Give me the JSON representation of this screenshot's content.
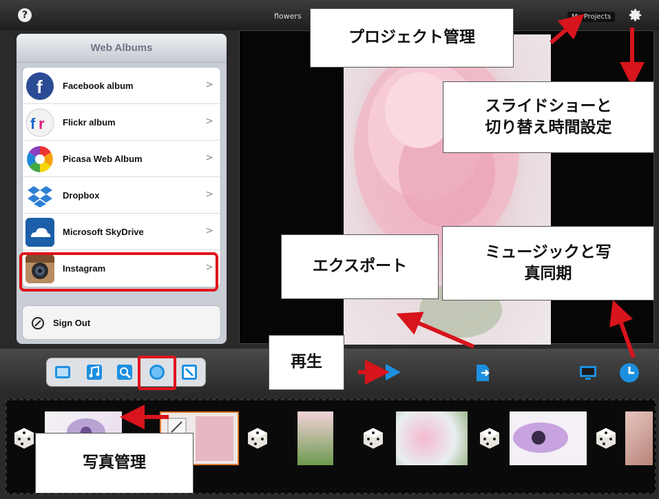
{
  "topbar": {
    "help_label": "?",
    "title": "flowers",
    "my_projects_label": "My Projects"
  },
  "sidebar": {
    "title": "Web Albums",
    "items": [
      {
        "label": "Facebook album",
        "icon": "facebook-icon"
      },
      {
        "label": "Flickr album",
        "icon": "flickr-icon"
      },
      {
        "label": "Picasa Web Album",
        "icon": "picasa-icon"
      },
      {
        "label": "Dropbox",
        "icon": "dropbox-icon"
      },
      {
        "label": "Microsoft SkyDrive",
        "icon": "skydrive-icon"
      },
      {
        "label": "Instagram",
        "icon": "instagram-icon"
      }
    ],
    "sign_out_label": "Sign Out",
    "chevron": ">"
  },
  "annotations": {
    "project": "プロジェクト管理",
    "slideshow_line1": "スライドショーと",
    "slideshow_line2": "切り替え時間設定",
    "export": "エクスポート",
    "music_line1": "ミュージックと写",
    "music_line2": "真同期",
    "play": "再生",
    "photo_manage": "写真管理"
  },
  "colors": {
    "highlight": "#e0141c",
    "accent_blue": "#1d8fe0",
    "arrow": "#d8141c"
  }
}
